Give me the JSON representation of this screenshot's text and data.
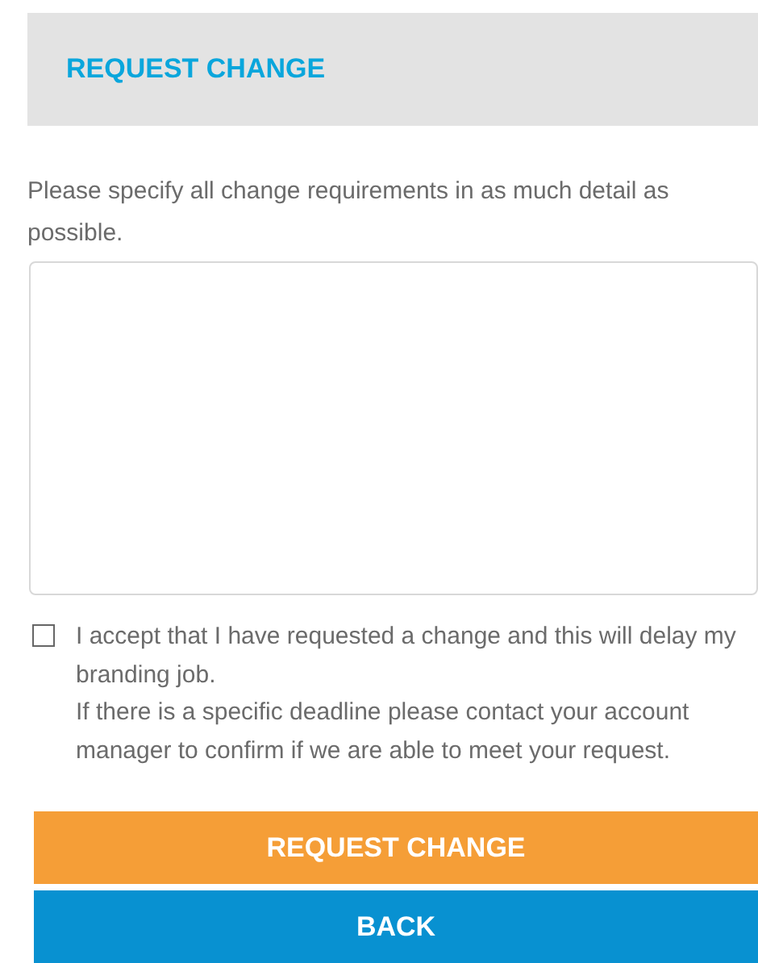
{
  "header": {
    "title": "REQUEST CHANGE"
  },
  "instructions": "Please specify all change requirements in as much detail as possible.",
  "acceptance": {
    "checked": false,
    "label": "I accept that I have requested a change and this will delay my branding job.",
    "note": "If there is a specific deadline please contact your account manager to confirm if we are able to meet your request."
  },
  "buttons": [
    {
      "label": "REQUEST CHANGE",
      "kind": "primary"
    },
    {
      "label": "BACK",
      "kind": "secondary"
    }
  ]
}
